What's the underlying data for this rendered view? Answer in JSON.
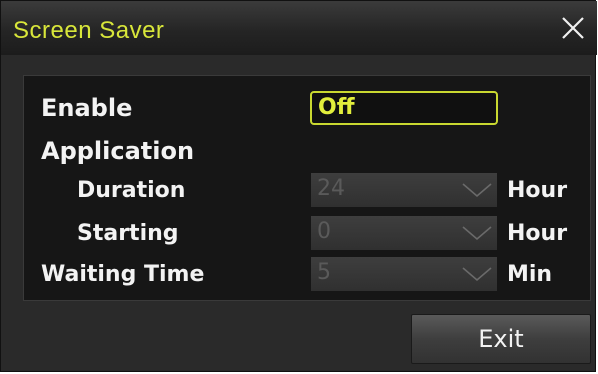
{
  "dialog": {
    "title": "Screen Saver",
    "close_icon": "close-x-icon"
  },
  "settings": {
    "enable_label": "Enable",
    "enable_value": "Off",
    "application_label": "Application",
    "duration_label": "Duration",
    "duration_value": "24",
    "duration_unit": "Hour",
    "starting_label": "Starting",
    "starting_value": "0",
    "starting_unit": "Hour",
    "waiting_label": "Waiting Time",
    "waiting_value": "5",
    "waiting_unit": "Min"
  },
  "footer": {
    "exit_label": "Exit"
  },
  "colors": {
    "accent": "#d8e63a",
    "panel_bg": "#161616",
    "dialog_bg": "#2a2a2a",
    "disabled_text": "#5a5a5a"
  }
}
